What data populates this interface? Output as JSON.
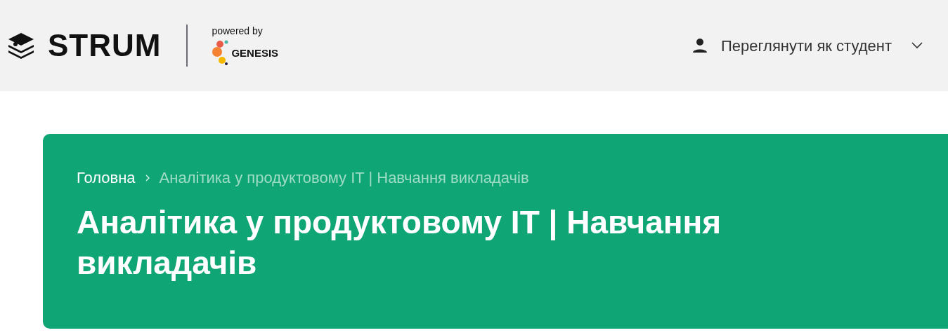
{
  "header": {
    "logo": "STRUM",
    "powered_by": "powered by",
    "partner": "GENESIS",
    "view_as": "Переглянути як студент"
  },
  "breadcrumbs": [
    {
      "label": "Головна",
      "current": false
    },
    {
      "label": "Аналітика у продуктовому IT | Навчання викладачів",
      "current": true
    }
  ],
  "title": "Аналітика у продуктовому IT | Навчання викладачів"
}
